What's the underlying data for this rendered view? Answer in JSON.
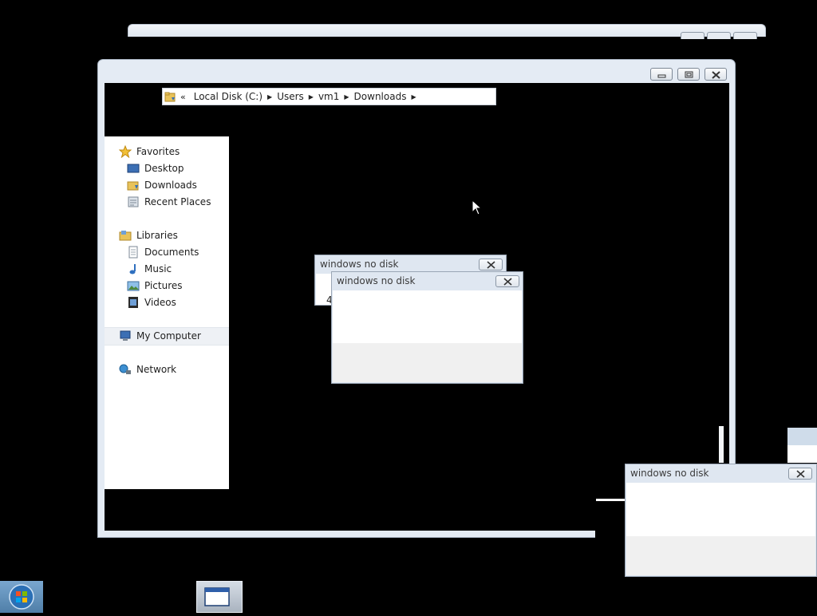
{
  "explorer": {
    "breadcrumb": {
      "overflow": "«",
      "segments": [
        "Local Disk (C:)",
        "Users",
        "vm1",
        "Downloads"
      ]
    },
    "nav": {
      "favorites_header": "Favorites",
      "favorites": [
        "Desktop",
        "Downloads",
        "Recent Places"
      ],
      "libraries_header": "Libraries",
      "libraries": [
        "Documents",
        "Music",
        "Pictures",
        "Videos"
      ],
      "computer": "My Computer",
      "network": "Network"
    }
  },
  "dialogs": [
    {
      "title": "windows no disk",
      "partial_text": "4"
    },
    {
      "title": "windows no disk"
    },
    {
      "title": "windows no disk"
    }
  ],
  "colors": {
    "desktop": "#000000",
    "window_frame": "#e4ebf4",
    "dialog_footer": "#f0f0f0"
  }
}
